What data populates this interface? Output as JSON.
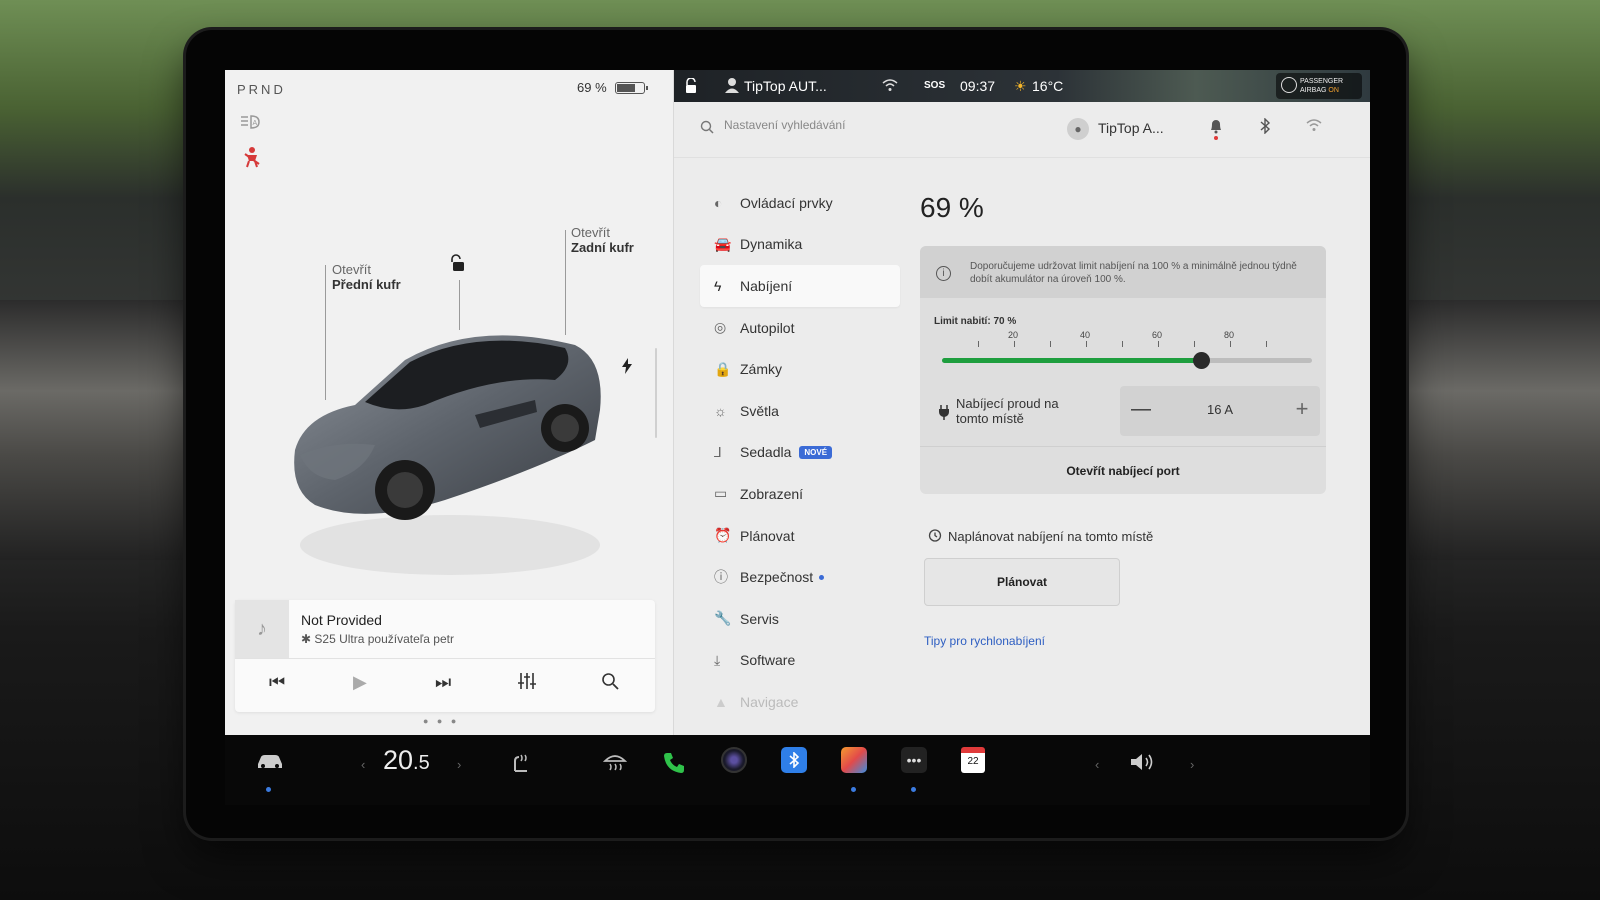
{
  "left_pane": {
    "gear": "PRND",
    "battery_percent": "69 %",
    "battery_level": 0.69,
    "front_trunk": {
      "action": "Otevřít",
      "name": "Přední kufr"
    },
    "rear_trunk": {
      "action": "Otevřít",
      "name": "Zadní kufr"
    },
    "icons": [
      "headlights-icon",
      "seatbelt-warning-icon",
      "unlock-icon",
      "charging-bolt-icon"
    ]
  },
  "media": {
    "title": "Not Provided",
    "subtitle": "S25 Ultra používateľa petr",
    "subtitle_icon": "bluetooth-icon",
    "controls": [
      "previous-icon",
      "play-icon",
      "next-icon",
      "equalizer-icon",
      "search-icon"
    ]
  },
  "status_bar": {
    "profile": "TipTop AUT...",
    "sos": "SOS",
    "time": "09:37",
    "temperature": "16°C",
    "airbag_line1": "PASSENGER",
    "airbag_line2": "AIRBAG",
    "airbag_state": "ON"
  },
  "settings": {
    "search_placeholder": "Nastavení vyhledávání",
    "user_name": "TipTop A...",
    "menu": [
      {
        "label": "Ovládací prvky",
        "icon": "toggle-icon"
      },
      {
        "label": "Dynamika",
        "icon": "car-icon"
      },
      {
        "label": "Nabíjení",
        "icon": "bolt-icon",
        "active": true
      },
      {
        "label": "Autopilot",
        "icon": "steering-wheel-icon"
      },
      {
        "label": "Zámky",
        "icon": "lock-icon"
      },
      {
        "label": "Světla",
        "icon": "sun-icon"
      },
      {
        "label": "Sedadla",
        "icon": "seat-icon",
        "badge": "NOVÉ"
      },
      {
        "label": "Zobrazení",
        "icon": "display-icon"
      },
      {
        "label": "Plánovat",
        "icon": "alarm-clock-icon"
      },
      {
        "label": "Bezpečnost",
        "icon": "alert-icon",
        "dot": true
      },
      {
        "label": "Servis",
        "icon": "wrench-icon"
      },
      {
        "label": "Software",
        "icon": "download-icon"
      },
      {
        "label": "Navigace",
        "icon": "navigation-icon"
      }
    ]
  },
  "charging": {
    "percent": "69 %",
    "note": "Doporučujeme udržovat limit nabíjení na 100 % a minimálně jednou týdně dobít akumulátor na úroveň 100 %.",
    "limit_label": "Limit nabití: 70 %",
    "limit_value": 70,
    "ticks": [
      "20",
      "40",
      "60",
      "80"
    ],
    "current_label": "Nabíjecí proud na tomto místě",
    "current_value": "16 A",
    "minus": "—",
    "plus": "+",
    "open_port": "Otevřít nabíjecí port",
    "schedule_label": "Naplánovat nabíjení na tomto místě",
    "schedule_button": "Plánovat",
    "tips_link": "Tipy pro rychlonabíjení"
  },
  "taskbar": {
    "temperature_int": "20",
    "temperature_dec": ".5",
    "calendar_day": "22",
    "items": [
      "car-icon",
      "seat-heat-icon",
      "defrost-icon",
      "phone-icon",
      "camera-icon",
      "bluetooth-icon",
      "games-icon",
      "more-icon",
      "calendar-icon",
      "volume-icon"
    ]
  },
  "colors": {
    "accent_green": "#1e9e3e",
    "accent_blue": "#3b6bd6",
    "alert_red": "#d63a3a"
  }
}
